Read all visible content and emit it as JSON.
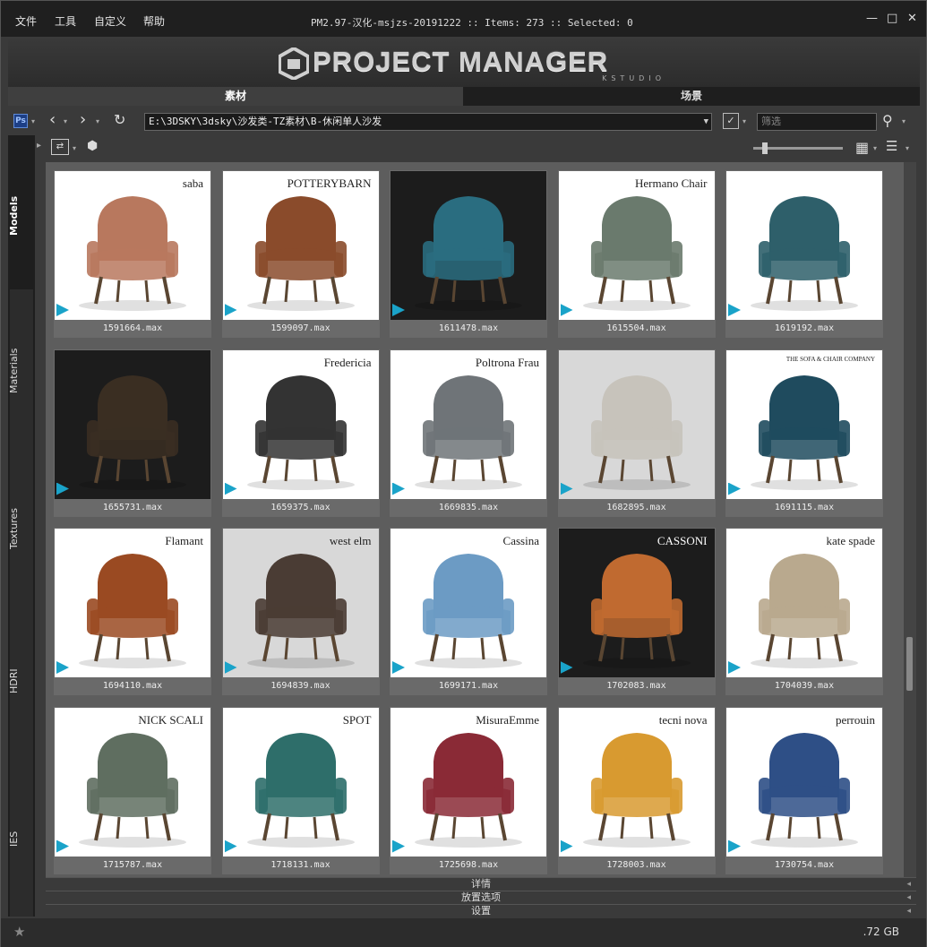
{
  "menu": [
    "文件",
    "工具",
    "自定义",
    "帮助"
  ],
  "window": {
    "title": "PM2.97-汉化-msjzs-20191222  :: Items: 273  :: Selected: 0",
    "minimize": "—",
    "maximize": "□",
    "close": "✕"
  },
  "banner": {
    "logo_text": "PROJECT MANAGER",
    "logo_sub": "KSTUDIO"
  },
  "tabs": [
    "素材",
    "场景"
  ],
  "toolbar": {
    "path": "E:\\3DSKY\\3dsky\\沙发类-TZ素材\\B-休闲单人沙发",
    "filter_placeholder": "筛选",
    "ps_label": "Ps"
  },
  "sidebar": [
    "Models",
    "Materials",
    "Textures",
    "HDRI",
    "IES"
  ],
  "items": [
    {
      "file": "1591664.max",
      "brand": "saba",
      "bg": "white",
      "color": "#b8785e"
    },
    {
      "file": "1599097.max",
      "brand": "POTTERYBARN",
      "bg": "white",
      "color": "#8a4b2b"
    },
    {
      "file": "1611478.max",
      "brand": "",
      "bg": "dark",
      "color": "#2a6d80"
    },
    {
      "file": "1615504.max",
      "brand": "Hermano Chair",
      "bg": "white",
      "color": "#6a7a6d"
    },
    {
      "file": "1619192.max",
      "brand": "",
      "bg": "white",
      "color": "#2e5f6a"
    },
    {
      "file": "1655731.max",
      "brand": "",
      "bg": "dark",
      "color": "#3a2e22"
    },
    {
      "file": "1659375.max",
      "brand": "Fredericia",
      "bg": "white",
      "color": "#333333"
    },
    {
      "file": "1669835.max",
      "brand": "Poltrona Frau",
      "bg": "white",
      "color": "#6f7478"
    },
    {
      "file": "1682895.max",
      "brand": "",
      "bg": "grey",
      "color": "#c7c3bb"
    },
    {
      "file": "1691115.max",
      "brand": "THE SOFA & CHAIR COMPANY",
      "bg": "white",
      "color": "#1f4b5e"
    },
    {
      "file": "1694110.max",
      "brand": "Flamant",
      "bg": "white",
      "color": "#9a4a22"
    },
    {
      "file": "1694839.max",
      "brand": "west elm",
      "bg": "grey",
      "color": "#4a3c34"
    },
    {
      "file": "1699171.max",
      "brand": "Cassina",
      "bg": "white",
      "color": "#6c9bc4"
    },
    {
      "file": "1702083.max",
      "brand": "CASSONI",
      "bg": "dark",
      "color": "#c06a30"
    },
    {
      "file": "1704039.max",
      "brand": "kate spade",
      "bg": "white",
      "color": "#b9a98e"
    },
    {
      "file": "1715787.max",
      "brand": "NICK SCALI",
      "bg": "white",
      "color": "#5f6e60"
    },
    {
      "file": "1718131.max",
      "brand": "SPOT",
      "bg": "white",
      "color": "#2e6e6a"
    },
    {
      "file": "1725698.max",
      "brand": "MisuraEmme",
      "bg": "white",
      "color": "#8a2a36"
    },
    {
      "file": "1728003.max",
      "brand": "tecni nova",
      "bg": "white",
      "color": "#d89a30"
    },
    {
      "file": "1730754.max",
      "brand": "perrouin",
      "bg": "white",
      "color": "#2e4f86"
    }
  ],
  "footer": [
    "详情",
    "放置选项",
    "设置"
  ],
  "status": {
    "disk": ".72 GB"
  }
}
